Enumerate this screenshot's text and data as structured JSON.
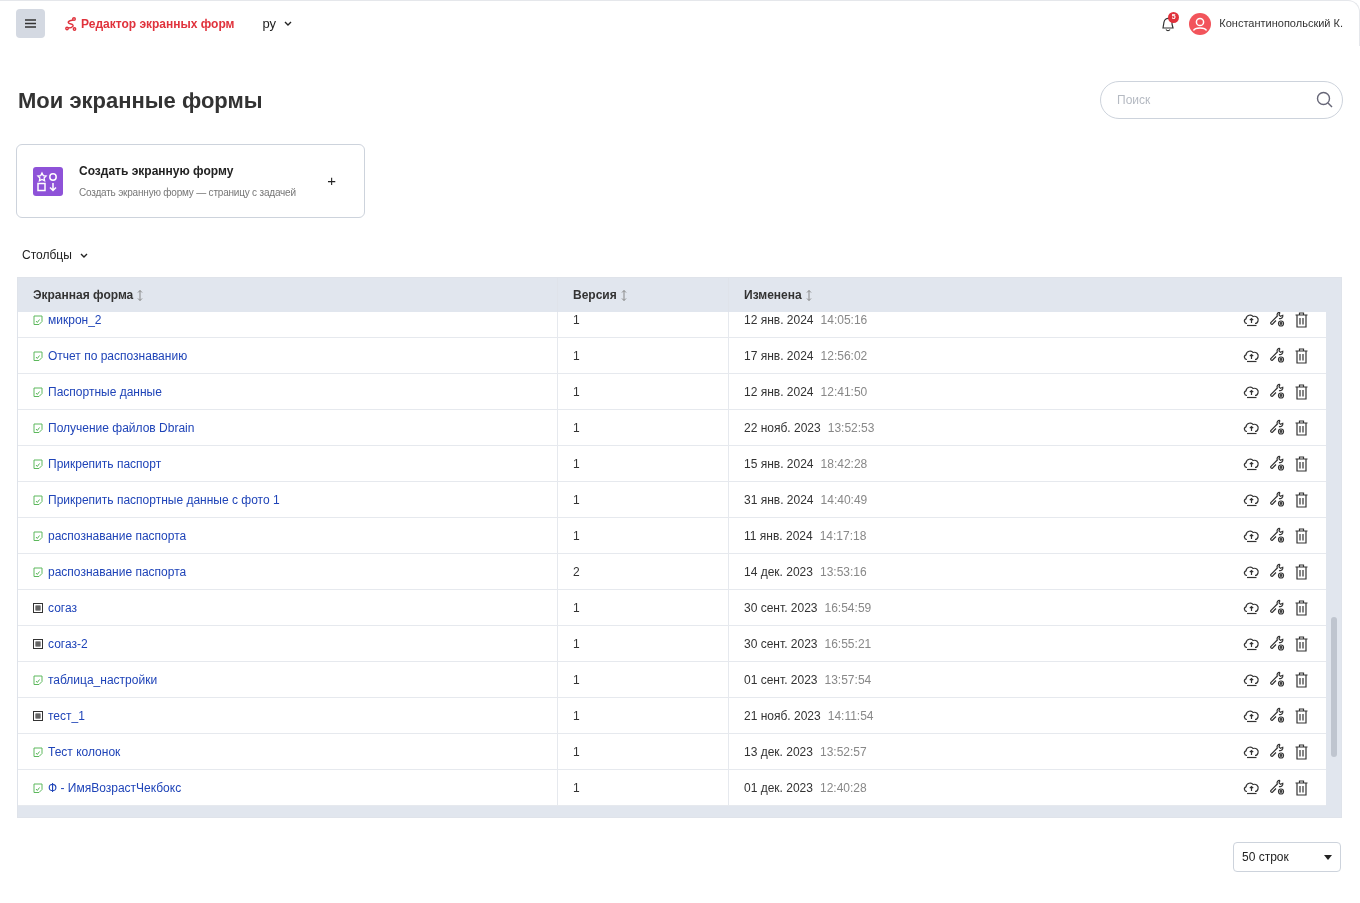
{
  "header": {
    "app_title": "Редактор экранных форм",
    "language": "ру",
    "notification_count": "5",
    "user_name": "Константинопольский К."
  },
  "page_title": "Мои экранные формы",
  "search": {
    "placeholder": "Поиск"
  },
  "create_card": {
    "title": "Создать экранную форму",
    "subtitle": "Создать экранную форму — страницу с задачей",
    "action": "+"
  },
  "columns_toggle": "Столбцы",
  "table": {
    "columns": [
      {
        "label": "Экранная форма",
        "sortable": true
      },
      {
        "label": "Версия",
        "sortable": true
      },
      {
        "label": "Изменена",
        "sortable": true
      }
    ],
    "rows": [
      {
        "kind": "form",
        "name": "микрон_2",
        "version": "1",
        "date": "12 янв. 2024",
        "time": "14:05:16"
      },
      {
        "kind": "form",
        "name": "Отчет по распознаванию",
        "version": "1",
        "date": "17 янв. 2024",
        "time": "12:56:02"
      },
      {
        "kind": "form",
        "name": "Паспортные данные",
        "version": "1",
        "date": "12 янв. 2024",
        "time": "12:41:50"
      },
      {
        "kind": "form",
        "name": "Получение файлов Dbrain",
        "version": "1",
        "date": "22 нояб. 2023",
        "time": "13:52:53"
      },
      {
        "kind": "form",
        "name": "Прикрепить паспорт",
        "version": "1",
        "date": "15 янв. 2024",
        "time": "18:42:28"
      },
      {
        "kind": "form",
        "name": "Прикрепить паспортные данные с фото 1",
        "version": "1",
        "date": "31 янв. 2024",
        "time": "14:40:49"
      },
      {
        "kind": "form",
        "name": "распознавание паспорта",
        "version": "1",
        "date": "11 янв. 2024",
        "time": "14:17:18"
      },
      {
        "kind": "form",
        "name": "распознавание паспорта",
        "version": "2",
        "date": "14 дек. 2023",
        "time": "13:53:16"
      },
      {
        "kind": "table",
        "name": "согаз",
        "version": "1",
        "date": "30 сент. 2023",
        "time": "16:54:59"
      },
      {
        "kind": "table",
        "name": "согаз-2",
        "version": "1",
        "date": "30 сент. 2023",
        "time": "16:55:21"
      },
      {
        "kind": "form",
        "name": "таблица_настройки",
        "version": "1",
        "date": "01 сент. 2023",
        "time": "13:57:54"
      },
      {
        "kind": "table",
        "name": "тест_1",
        "version": "1",
        "date": "21 нояб. 2023",
        "time": "14:11:54"
      },
      {
        "kind": "form",
        "name": "Тест колонок",
        "version": "1",
        "date": "13 дек. 2023",
        "time": "13:52:57"
      },
      {
        "kind": "form",
        "name": "Ф - ИмяВозрастЧекбокс",
        "version": "1",
        "date": "01 дек. 2023",
        "time": "12:40:28"
      }
    ]
  },
  "pagination": {
    "rows_per_page": "50 строк"
  }
}
